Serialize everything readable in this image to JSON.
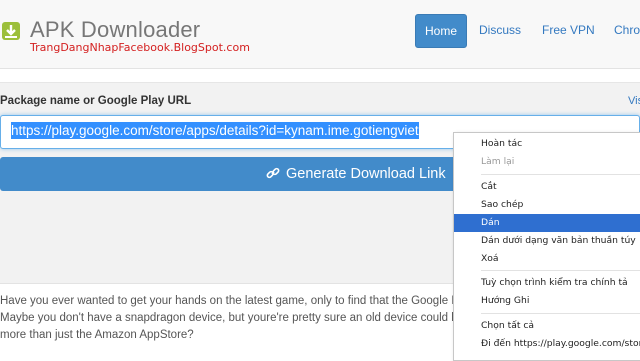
{
  "header": {
    "app_title": "APK Downloader",
    "watermark": "TrangDangNhapFacebook.BlogSpot.com",
    "nav": [
      "Home",
      "Discuss",
      "Free VPN",
      "Chrome"
    ]
  },
  "form": {
    "label": "Package name or Google Play URL",
    "side_link": "Vis",
    "url_value": "https://play.google.com/store/apps/details?id=kynam.ime.gotiengviet",
    "generate_label": "Generate Download Link"
  },
  "description": [
    "Have you ever wanted to get your hands on the latest game, only to find that the Google Play",
    "Maybe you don't have a snapdragon device, but youre're pretty sure an old device could han",
    "more than just the Amazon AppStore?"
  ],
  "context_menu": {
    "items": [
      {
        "label": "Hoàn tác",
        "state": "normal"
      },
      {
        "label": "Làm lại",
        "state": "disabled"
      },
      {
        "label": "Cắt",
        "state": "normal"
      },
      {
        "label": "Sao chép",
        "state": "normal"
      },
      {
        "label": "Dán",
        "state": "highlighted"
      },
      {
        "label": "Dán dưới dạng văn bản thuần túy",
        "state": "normal"
      },
      {
        "label": "Xoá",
        "state": "normal"
      },
      {
        "label": "Tuỳ chọn trình kiểm tra chính tả",
        "state": "normal"
      },
      {
        "label": "Hướng Ghi",
        "state": "normal"
      },
      {
        "label": "Chọn tất cả",
        "state": "normal"
      },
      {
        "label": "Đi đến https://play.google.com/store/a",
        "state": "normal"
      }
    ]
  },
  "colors": {
    "primary": "#428bca",
    "selection": "#3390ff",
    "menu_highlight": "#2f6fd0",
    "watermark": "#d42020"
  },
  "icons": {
    "logo": "android-download-icon",
    "generate": "link-icon"
  }
}
